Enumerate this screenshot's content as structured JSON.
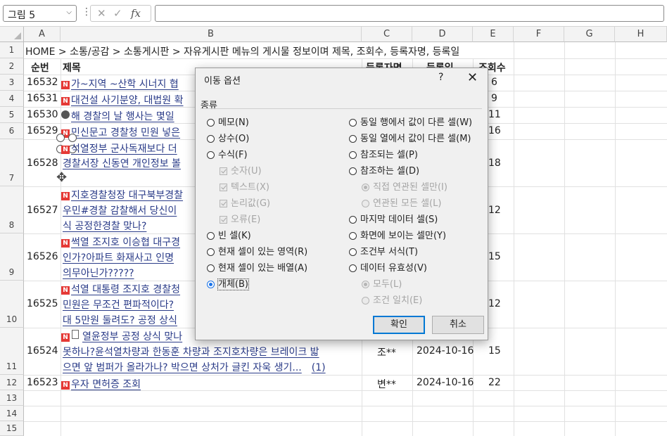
{
  "formula_bar": {
    "name_box": "그림 5",
    "menu_dots": "⋮",
    "cancel_icon": "✕",
    "enter_icon": "✓",
    "fx": "fx",
    "content": ""
  },
  "columns": [
    "A",
    "B",
    "C",
    "D",
    "E",
    "F",
    "G",
    "H"
  ],
  "rows": [
    "1",
    "2",
    "3",
    "4",
    "5",
    "6",
    "7",
    "8",
    "9",
    "10",
    "11",
    "12",
    "13",
    "14",
    "15"
  ],
  "cells": {
    "r1": "HOME > 소통/공감 > 소통게시판 > 자유게시판 메뉴의 게시물 정보이며 제목, 조회수, 등록자명, 등록일",
    "header": {
      "num": "순번",
      "title": "제목",
      "author": "등록자명",
      "date": "등록일",
      "views": "조회수"
    },
    "r3": {
      "num": "16532",
      "title": "가~지역 ~산학 시너지 협",
      "views": "6"
    },
    "r4": {
      "num": "16531",
      "title": "대건설 사기분양, 대법원 확",
      "views": "9"
    },
    "r5": {
      "num": "16530",
      "title": "해 경찰의 날 행사는 몇일",
      "views": "11"
    },
    "r6": {
      "num": "16529",
      "title": "민신문고 경찰청 민원 넣은",
      "views": "16"
    },
    "r7": {
      "num": "16528",
      "title1": "석열정부 군사독재보다 더",
      "title2": "경찰서장 신동연 개인정보 볼",
      "views": "18"
    },
    "r8": {
      "num": "16527",
      "title1": "지호경찰청장 대구북부경찰",
      "title2": "우민#경찰 감찰해서 당신이",
      "title3": "식 공정한경찰 맞나?",
      "views": "12"
    },
    "r9": {
      "num": "16526",
      "title1": "썩열 조지호 이승협 대구경",
      "title2": "인가?아파트 화재사고 인명",
      "title3": "의무아닌가?????",
      "views": "15"
    },
    "r10": {
      "num": "16525",
      "title1": "석열 대통령 조지호 경찰청",
      "title2": "민원은 무조건 편파적이다?",
      "title3": "대 5만원 둘려도? 공정 상식",
      "views": "12"
    },
    "r11": {
      "num": "16524",
      "title1": "열윤정부 공정 상식 맞나",
      "title2": "못하나?윤석열차량과 한동훈 차량과 조지호차량은 브레이크 밟",
      "title3": "으면 앞 범퍼가 올라가나? 박으면 상처가 글킨 자욱 생기...",
      "comment": "(1)",
      "author": "조**",
      "date": "2024-10-16",
      "views": "15"
    },
    "r12": {
      "num": "16523",
      "title": "우자 면허증 조회",
      "author": "변**",
      "date": "2024-10-16",
      "views": "22"
    },
    "badge": "N"
  },
  "dialog": {
    "title": "이동 옵션",
    "help": "?",
    "close": "✕",
    "group_label": "종류",
    "left_options": [
      {
        "label": "메모(N)",
        "enabled": true,
        "checked": false
      },
      {
        "label": "상수(O)",
        "enabled": true,
        "checked": false
      },
      {
        "label": "수식(F)",
        "enabled": true,
        "checked": false
      },
      {
        "label": "숫자(U)",
        "enabled": false,
        "checked": true,
        "type": "checkbox"
      },
      {
        "label": "텍스트(X)",
        "enabled": false,
        "checked": true,
        "type": "checkbox"
      },
      {
        "label": "논리값(G)",
        "enabled": false,
        "checked": true,
        "type": "checkbox"
      },
      {
        "label": "오류(E)",
        "enabled": false,
        "checked": true,
        "type": "checkbox"
      },
      {
        "label": "빈 셀(K)",
        "enabled": true,
        "checked": false
      },
      {
        "label": "현재 셀이 있는 영역(R)",
        "enabled": true,
        "checked": false
      },
      {
        "label": "현재 셀이 있는 배열(A)",
        "enabled": true,
        "checked": false
      },
      {
        "label": "개체(B)",
        "enabled": true,
        "checked": true
      }
    ],
    "right_options": [
      {
        "label": "동일 행에서 값이 다른 셀(W)",
        "enabled": true,
        "checked": false
      },
      {
        "label": "동일 열에서 값이 다른 셀(M)",
        "enabled": true,
        "checked": false
      },
      {
        "label": "참조되는 셀(P)",
        "enabled": true,
        "checked": false
      },
      {
        "label": "참조하는 셀(D)",
        "enabled": true,
        "checked": false
      },
      {
        "label": "직접 연관된 셀만(I)",
        "enabled": false,
        "checked": true
      },
      {
        "label": "연관된 모든 셀(L)",
        "enabled": false,
        "checked": false
      },
      {
        "label": "마지막 데이터 셀(S)",
        "enabled": true,
        "checked": false
      },
      {
        "label": "화면에 보이는 셀만(Y)",
        "enabled": true,
        "checked": false
      },
      {
        "label": "조건부 서식(T)",
        "enabled": true,
        "checked": false
      },
      {
        "label": "데이터 유효성(V)",
        "enabled": true,
        "checked": false
      },
      {
        "label": "모두(L)",
        "enabled": false,
        "checked": true
      },
      {
        "label": "조건 일치(E)",
        "enabled": false,
        "checked": false
      }
    ],
    "ok": "확인",
    "cancel": "취소"
  }
}
